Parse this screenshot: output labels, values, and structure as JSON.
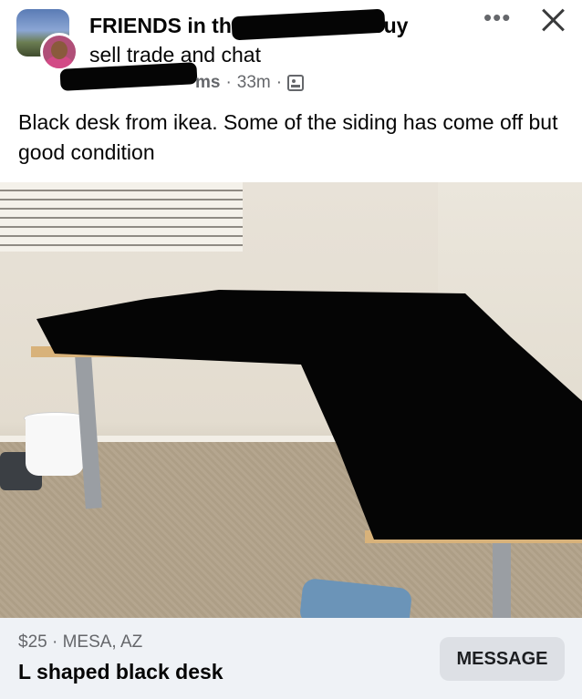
{
  "post": {
    "group_title_line1_start": "FRIENDS in th",
    "group_title_line1_end": "az buy",
    "group_title_line2": "sell trade and chat",
    "author_suffix": "ms",
    "separator": "·",
    "time": "33m",
    "body": "Black desk from ikea. Some of the siding has come off but good condition"
  },
  "icons": {
    "more": "more-options-icon",
    "close": "close-icon",
    "audience": "members-audience-icon"
  },
  "header_actions": {
    "more_label": "•••"
  },
  "listing": {
    "price_location": "$25 · MESA, AZ",
    "title": "L shaped black desk",
    "message_label": "MESSAGE"
  },
  "colors": {
    "secondary_text": "#65676b",
    "listing_bg": "#eff2f6",
    "button_bg": "#dde0e5"
  }
}
